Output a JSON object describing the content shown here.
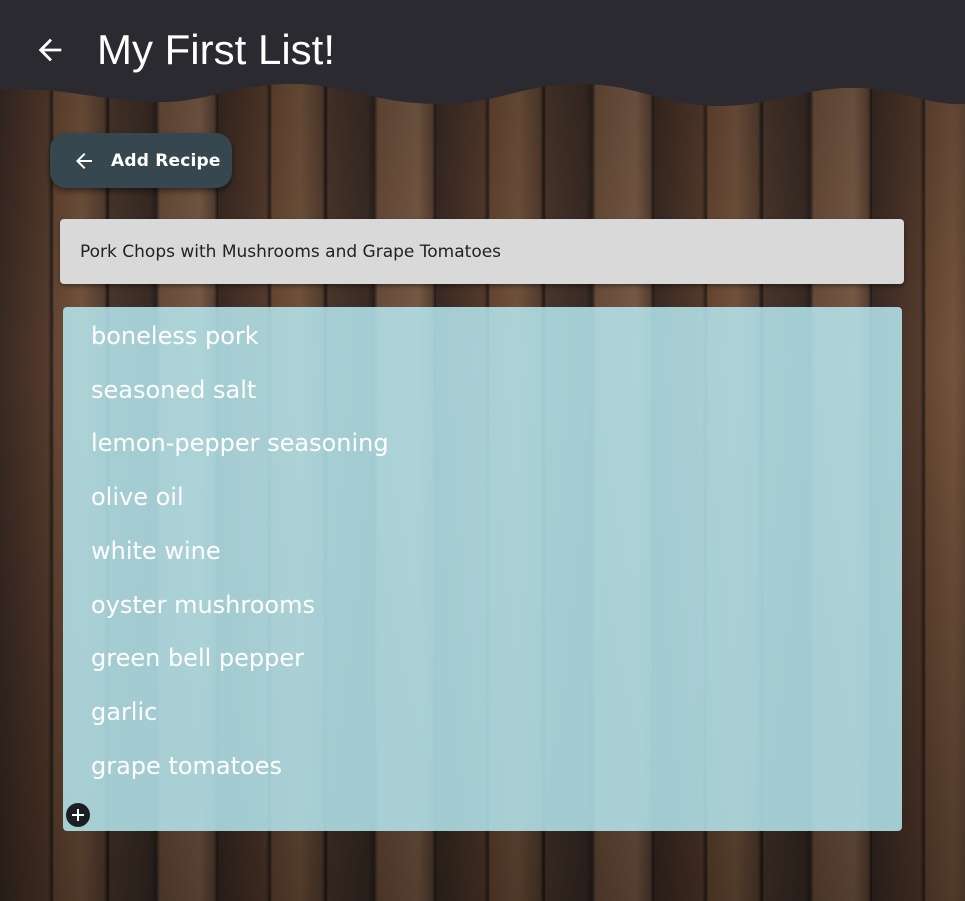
{
  "app_bar": {
    "title": "My First List!",
    "background": "#2b2a30",
    "back_icon": "arrow-left-icon"
  },
  "add_recipe_button": {
    "label": "Add Recipe",
    "icon": "arrow-left-icon",
    "background": "#37474f"
  },
  "recipe_field": {
    "value": "Pork Chops with Mushrooms and Grape Tomatoes"
  },
  "ingredients": {
    "items": [
      "boneless pork",
      "seasoned salt",
      "lemon-pepper seasoning",
      "olive oil",
      "white wine",
      "oyster mushrooms",
      "green bell pepper",
      "garlic",
      "grape tomatoes"
    ],
    "add_icon": "plus-circle-icon",
    "background": "#b6e8f0"
  }
}
